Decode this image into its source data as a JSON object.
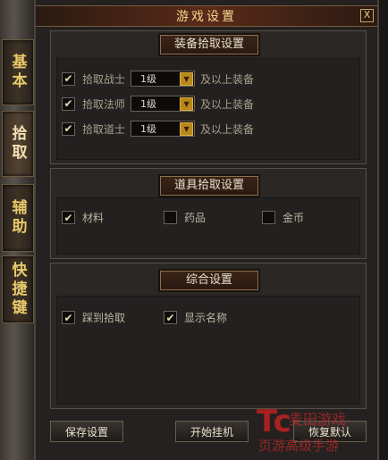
{
  "side_tabs": [
    {
      "label": "基本",
      "active": false
    },
    {
      "label": "拾取",
      "active": true
    },
    {
      "label": "辅助",
      "active": false
    },
    {
      "label": "快捷键",
      "active": false
    }
  ],
  "window": {
    "title": "游戏设置",
    "close_label": "X"
  },
  "equip_group": {
    "title": "装备拾取设置",
    "rows": [
      {
        "checked": true,
        "label": "拾取战士",
        "level": "1级",
        "suffix": "及以上装备"
      },
      {
        "checked": true,
        "label": "拾取法师",
        "level": "1级",
        "suffix": "及以上装备"
      },
      {
        "checked": true,
        "label": "拾取道士",
        "level": "1级",
        "suffix": "及以上装备"
      }
    ]
  },
  "item_group": {
    "title": "道具拾取设置",
    "options": [
      {
        "checked": true,
        "label": "材料"
      },
      {
        "checked": false,
        "label": "药品"
      },
      {
        "checked": false,
        "label": "金币"
      }
    ]
  },
  "general_group": {
    "title": "综合设置",
    "options": [
      {
        "checked": true,
        "label": "踩到拾取"
      },
      {
        "checked": true,
        "label": "显示名称"
      }
    ]
  },
  "buttons": {
    "save": "保存设置",
    "start": "开始挂机",
    "restore": "恢复默认"
  },
  "watermark": {
    "logo": "Tc",
    "line1": "麦田游戏",
    "line2": "页游高级手游"
  },
  "colors": {
    "accent_gold": "#e8c96a",
    "dropdown_arrow": "#b8881c",
    "watermark_red": "#c02020"
  }
}
